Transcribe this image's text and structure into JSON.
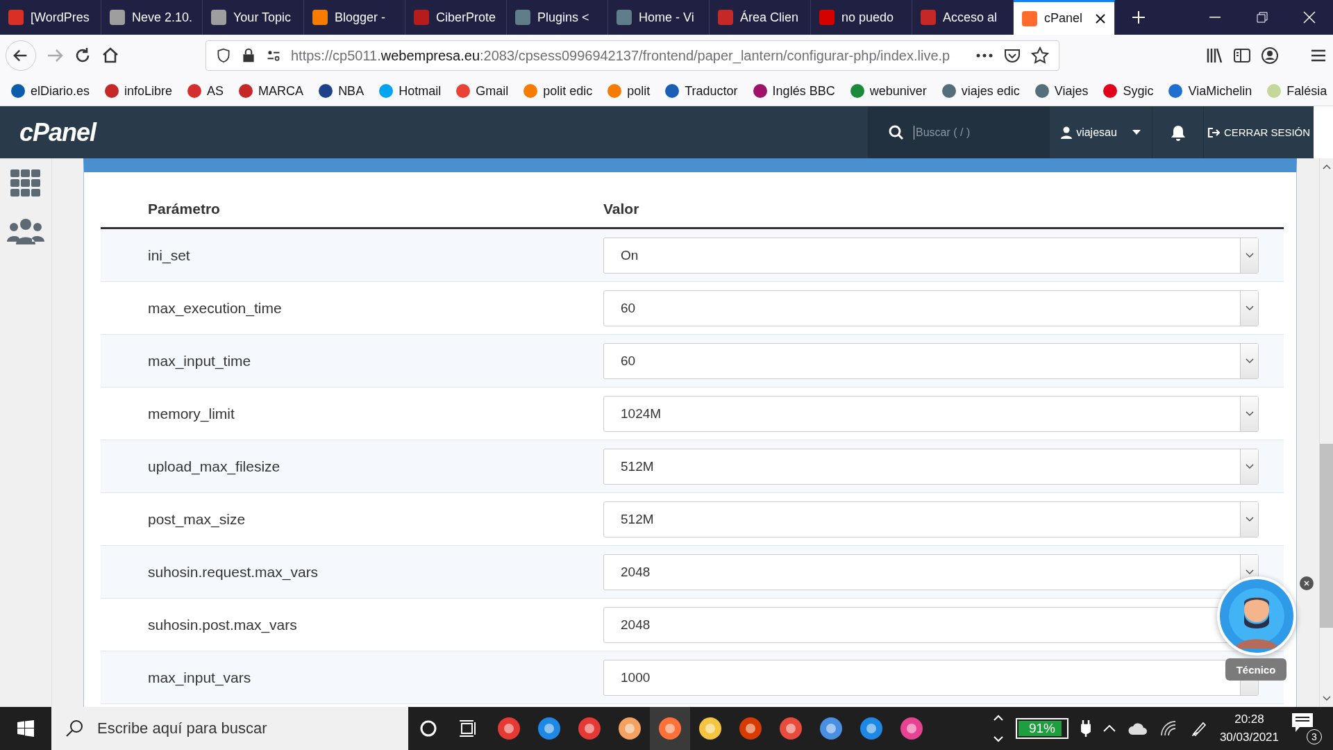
{
  "browser": {
    "tabs": [
      {
        "title": "[WordPres",
        "color": "#d93025",
        "selected": false
      },
      {
        "title": "Neve 2.10.",
        "color": "#9e9e9e",
        "selected": false
      },
      {
        "title": "Your Topic",
        "color": "#9e9e9e",
        "selected": false
      },
      {
        "title": "Blogger - ",
        "color": "#f57c00",
        "selected": false
      },
      {
        "title": "CiberProte",
        "color": "#b71c1c",
        "selected": false
      },
      {
        "title": "Plugins < ",
        "color": "#607d8b",
        "selected": false
      },
      {
        "title": "Home - Vi",
        "color": "#607d8b",
        "selected": false
      },
      {
        "title": "Área Clien",
        "color": "#c62828",
        "selected": false
      },
      {
        "title": "no puedo ",
        "color": "#d50000",
        "selected": false
      },
      {
        "title": "Acceso al ",
        "color": "#c62828",
        "selected": false
      },
      {
        "title": "cPanel",
        "color": "#ff6c2c",
        "selected": true
      }
    ],
    "url_parts": [
      {
        "text": "https://cp5011.",
        "emphasis": false
      },
      {
        "text": "webempresa.eu",
        "emphasis": true
      },
      {
        "text": ":2083/cpsess0996942137/frontend/paper_lantern/configurar-php/index.live.p",
        "emphasis": false
      }
    ],
    "bookmarks": [
      {
        "label": "elDiario.es",
        "color": "#0b5cab"
      },
      {
        "label": "infoLibre",
        "color": "#c62828"
      },
      {
        "label": "AS",
        "color": "#d32f2f"
      },
      {
        "label": "MARCA",
        "color": "#c62828"
      },
      {
        "label": "NBA",
        "color": "#1d428a"
      },
      {
        "label": "Hotmail",
        "color": "#00a4ef"
      },
      {
        "label": "Gmail",
        "color": "#ea4335"
      },
      {
        "label": "polit edic",
        "color": "#f57c00"
      },
      {
        "label": "polit",
        "color": "#f57c00"
      },
      {
        "label": "Traductor",
        "color": "#1a5fb4"
      },
      {
        "label": "Inglés BBC",
        "color": "#a0126a"
      },
      {
        "label": "webuniver",
        "color": "#1b8a3a"
      },
      {
        "label": "viajes edic",
        "color": "#546e7a"
      },
      {
        "label": "Viajes",
        "color": "#546e7a"
      },
      {
        "label": "Sygic",
        "color": "#e3001b"
      },
      {
        "label": "ViaMichelin",
        "color": "#1e6fd0"
      },
      {
        "label": "Falésia",
        "color": "#c5d89a"
      }
    ]
  },
  "cpanel_header": {
    "logo": "cPanel",
    "search": {
      "placeholder": "Buscar ( / )"
    },
    "user": "viajesau",
    "logout": "CERRAR SESIÓN"
  },
  "table": {
    "columns": [
      "Parámetro",
      "Valor"
    ],
    "rows": [
      {
        "parameter": "ini_set",
        "value": "On"
      },
      {
        "parameter": "max_execution_time",
        "value": "60"
      },
      {
        "parameter": "max_input_time",
        "value": "60"
      },
      {
        "parameter": "memory_limit",
        "value": "1024M"
      },
      {
        "parameter": "upload_max_filesize",
        "value": "512M"
      },
      {
        "parameter": "post_max_size",
        "value": "512M"
      },
      {
        "parameter": "suhosin.request.max_vars",
        "value": "2048"
      },
      {
        "parameter": "suhosin.post.max_vars",
        "value": "2048"
      },
      {
        "parameter": "max_input_vars",
        "value": "1000"
      }
    ]
  },
  "chat_widget": {
    "label": "Técnico"
  },
  "taskbar": {
    "search": {
      "placeholder": "Escribe aquí para buscar"
    },
    "battery": {
      "reading": "91%",
      "level": 0.91
    },
    "time": "20:28",
    "date": "30/03/2021",
    "notifications": "3"
  }
}
